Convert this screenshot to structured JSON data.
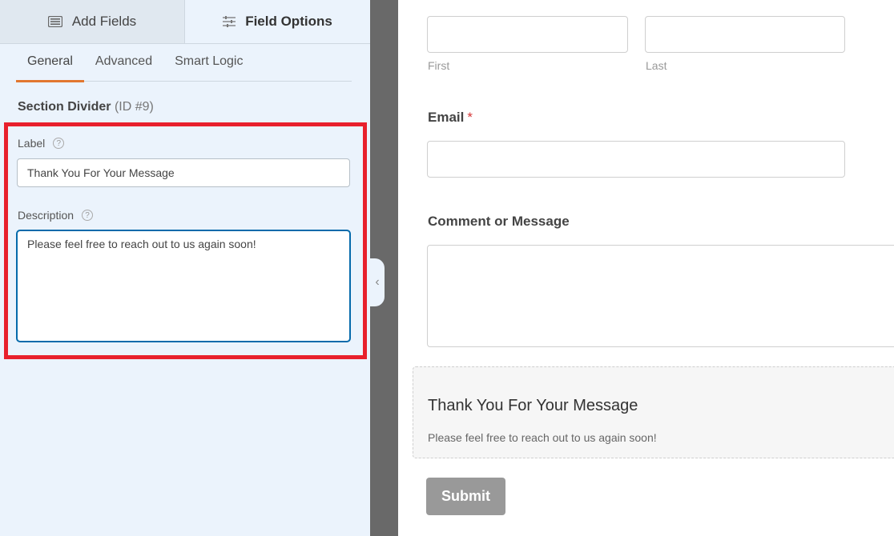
{
  "top_tabs": [
    {
      "label": "Add Fields",
      "icon": "list-icon",
      "active": false
    },
    {
      "label": "Field Options",
      "icon": "sliders-icon",
      "active": true
    }
  ],
  "sub_tabs": [
    {
      "label": "General",
      "active": true
    },
    {
      "label": "Advanced",
      "active": false
    },
    {
      "label": "Smart Logic",
      "active": false
    }
  ],
  "field": {
    "type_name": "Section Divider",
    "id_text": "(ID #9)"
  },
  "options": {
    "label_title": "Label",
    "label_value": "Thank You For Your Message",
    "description_title": "Description",
    "description_value": "Please feel free to reach out to us again soon!",
    "help_glyph": "?"
  },
  "collapse_glyph": "‹",
  "form": {
    "name_sublabels": {
      "first": "First",
      "last": "Last"
    },
    "email_label": "Email",
    "required_marker": "*",
    "comment_label": "Comment or Message",
    "divider_title": "Thank You For Your Message",
    "divider_description": "Please feel free to reach out to us again soon!",
    "submit_label": "Submit"
  },
  "colors": {
    "accent_orange": "#e27730",
    "highlight_red": "#e8202c",
    "focus_blue": "#056aab",
    "panel_bg": "#ebf3fc"
  }
}
